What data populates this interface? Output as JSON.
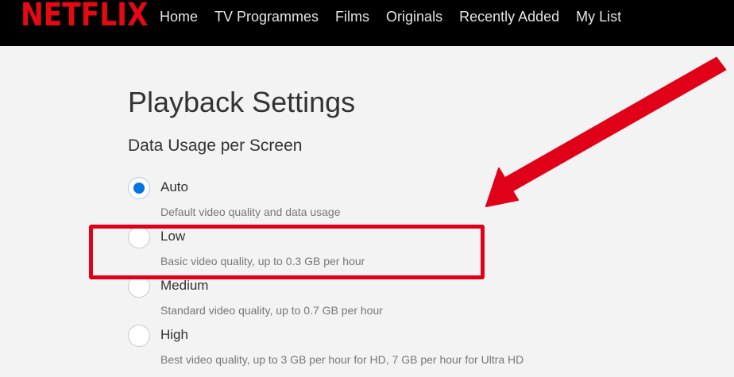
{
  "header": {
    "logo": "NETFLIX",
    "nav": [
      "Home",
      "TV Programmes",
      "Films",
      "Originals",
      "Recently Added",
      "My List"
    ]
  },
  "page": {
    "title": "Playback Settings",
    "section": "Data Usage per Screen"
  },
  "options": [
    {
      "label": "Auto",
      "description": "Default video quality and data usage",
      "selected": true
    },
    {
      "label": "Low",
      "description": "Basic video quality, up to 0.3 GB per hour",
      "selected": false
    },
    {
      "label": "Medium",
      "description": "Standard video quality, up to 0.7 GB per hour",
      "selected": false
    },
    {
      "label": "High",
      "description": "Best video quality, up to 3 GB per hour for HD, 7 GB per hour for Ultra HD",
      "selected": false
    }
  ],
  "colors": {
    "brand": "#e50914",
    "radio_selected": "#0074e0",
    "annotation": "#e00018"
  }
}
